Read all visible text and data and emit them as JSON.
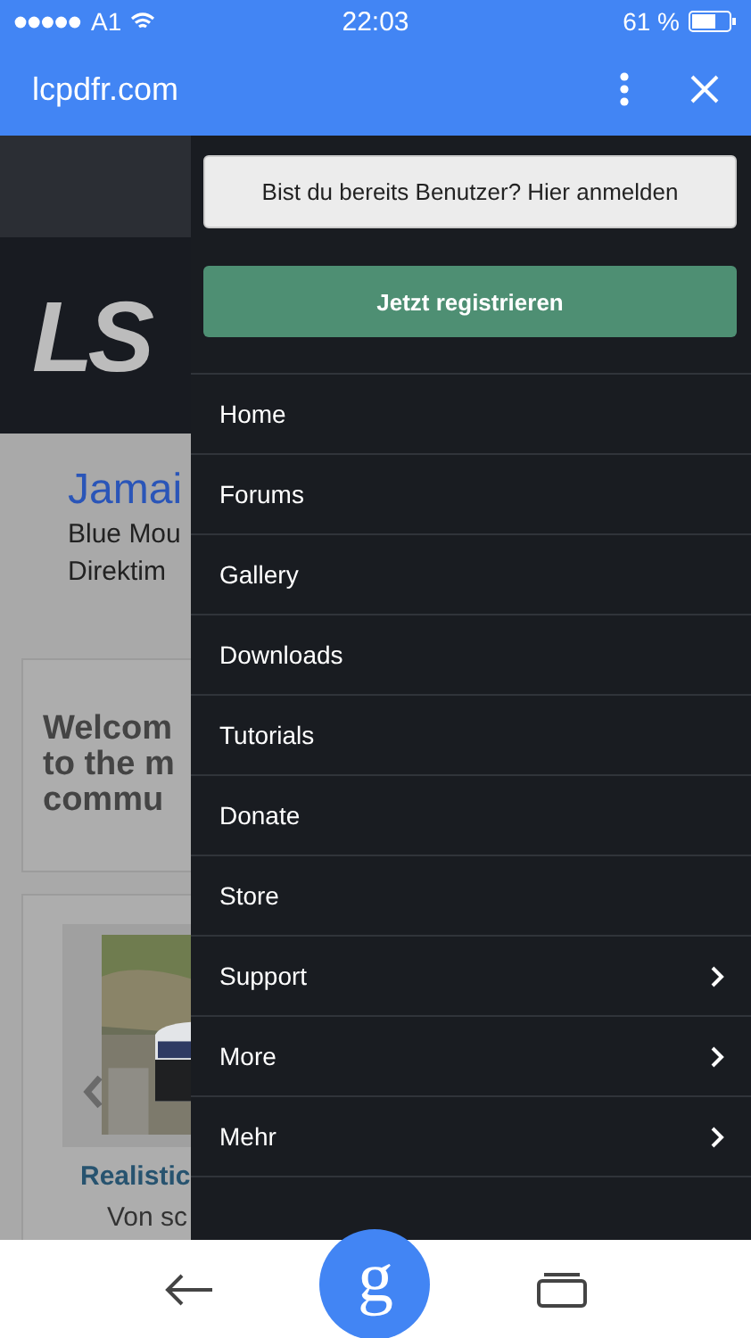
{
  "status_bar": {
    "carrier": "A1",
    "time": "22:03",
    "battery": "61 %"
  },
  "app_bar": {
    "title": "lcpdfr.com"
  },
  "background_page": {
    "logo": "LS",
    "ad_title": "Jamai",
    "ad_lines": [
      "Blue Mou",
      "Direktim"
    ],
    "welcome_lines": [
      "Welcom",
      "to the m",
      "commu"
    ],
    "article_title": "Realistic",
    "article_byline": "Von sc"
  },
  "drawer": {
    "login_button": "Bist du bereits Benutzer? Hier anmelden",
    "register_button": "Jetzt registrieren",
    "items": [
      {
        "label": "Home",
        "has_submenu": false
      },
      {
        "label": "Forums",
        "has_submenu": false
      },
      {
        "label": "Gallery",
        "has_submenu": false
      },
      {
        "label": "Downloads",
        "has_submenu": false
      },
      {
        "label": "Tutorials",
        "has_submenu": false
      },
      {
        "label": "Donate",
        "has_submenu": false
      },
      {
        "label": "Store",
        "has_submenu": false
      },
      {
        "label": "Support",
        "has_submenu": true
      },
      {
        "label": "More",
        "has_submenu": true
      },
      {
        "label": "Mehr",
        "has_submenu": true
      }
    ]
  },
  "bottom_bar": {
    "google_button": "g"
  }
}
